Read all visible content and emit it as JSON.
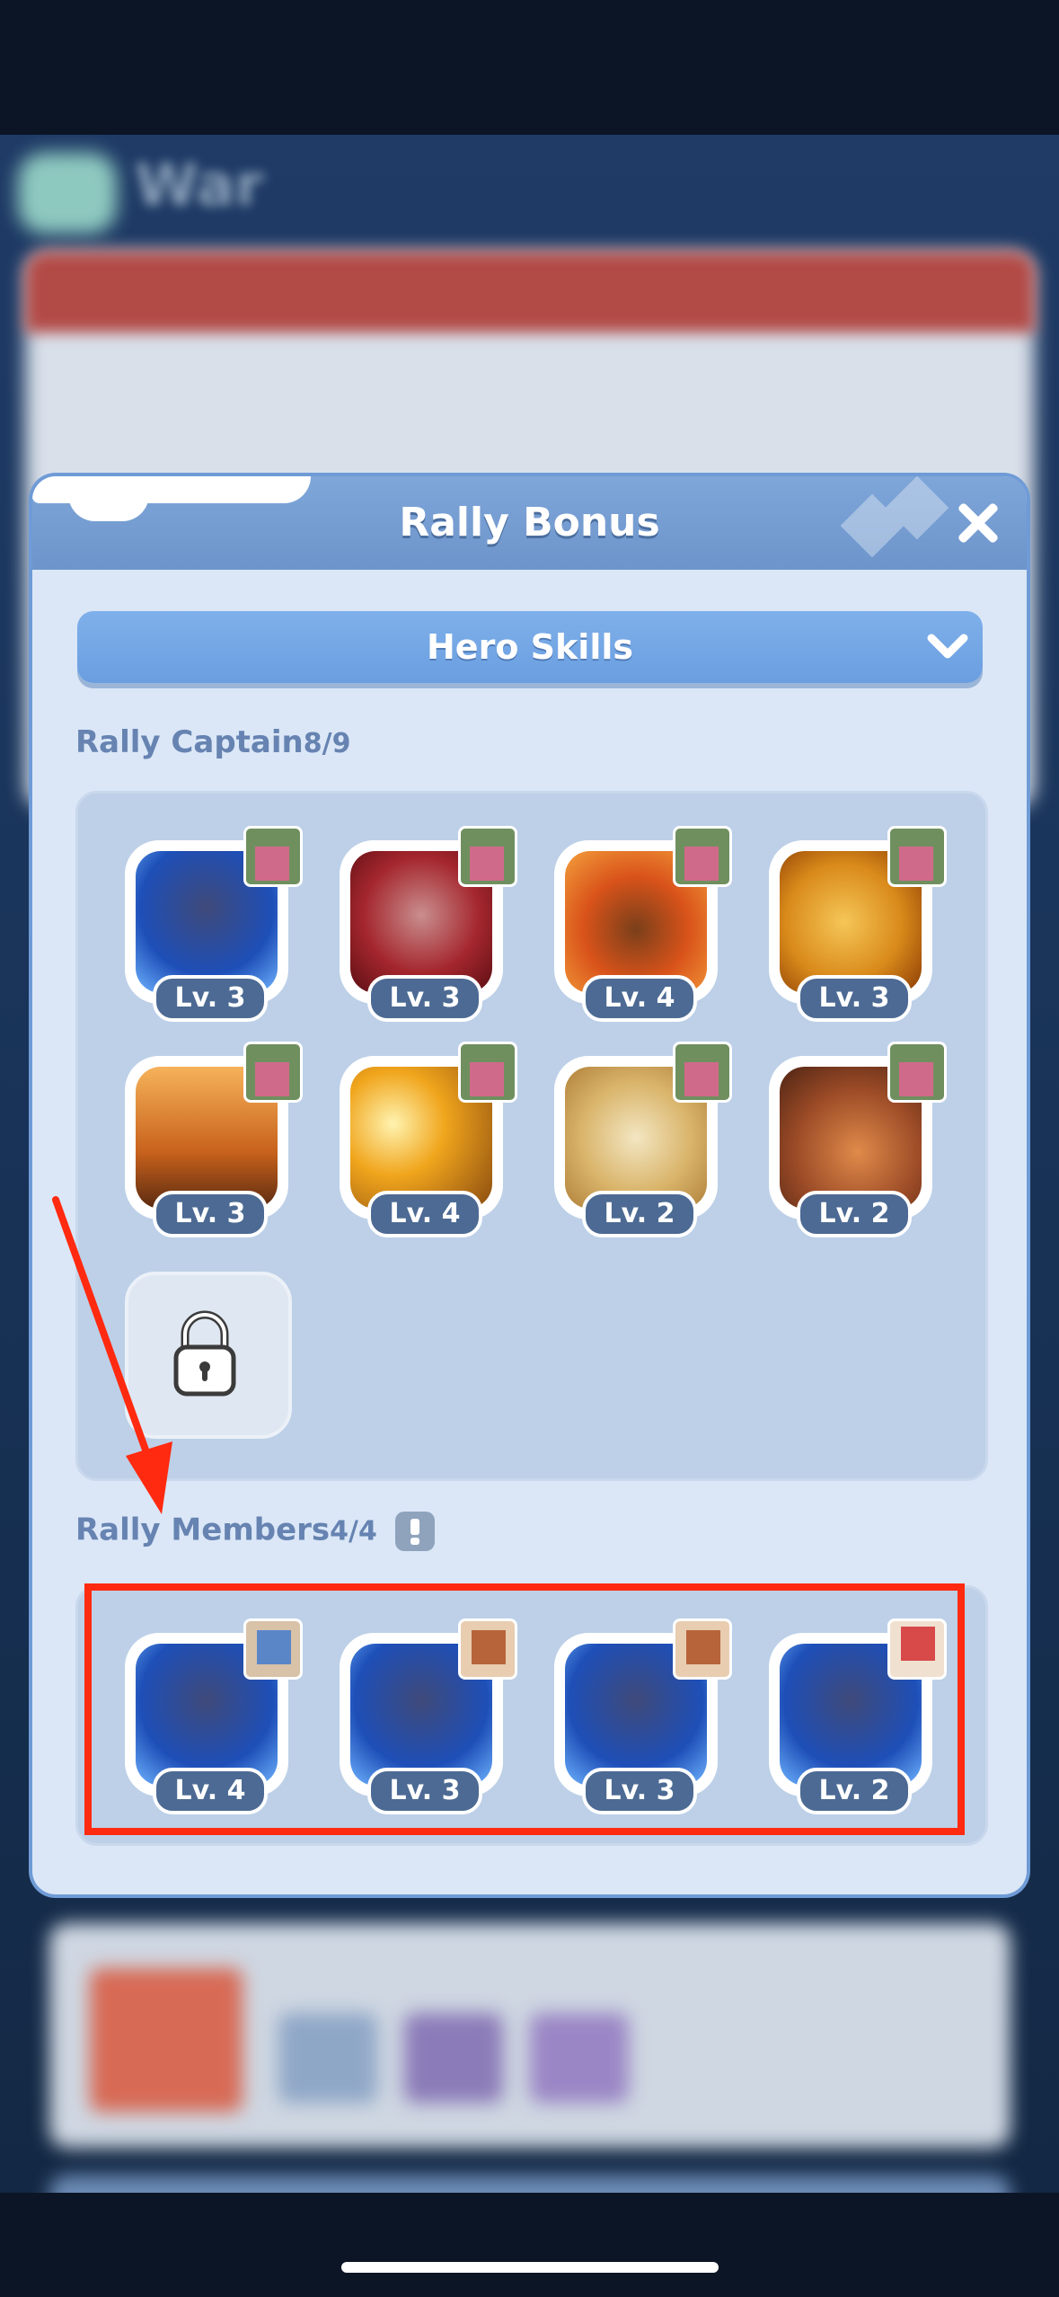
{
  "background": {
    "title": "War"
  },
  "modal": {
    "title": "Rally Bonus",
    "dropdown_label": "Hero Skills"
  },
  "rally_captain": {
    "label": "Rally Captain",
    "count": "8/9",
    "skills": [
      {
        "level": "Lv. 3"
      },
      {
        "level": "Lv. 3"
      },
      {
        "level": "Lv. 4"
      },
      {
        "level": "Lv. 3"
      },
      {
        "level": "Lv. 3"
      },
      {
        "level": "Lv. 4"
      },
      {
        "level": "Lv. 2"
      },
      {
        "level": "Lv. 2"
      }
    ]
  },
  "rally_members": {
    "label": "Rally Members",
    "count": "4/4",
    "skills": [
      {
        "level": "Lv. 4"
      },
      {
        "level": "Lv. 3"
      },
      {
        "level": "Lv. 3"
      },
      {
        "level": "Lv. 2"
      }
    ]
  },
  "colors": {
    "highlight": "#ff2a10",
    "modal_bg": "#dbe7f7",
    "header": "#6d95cb"
  }
}
